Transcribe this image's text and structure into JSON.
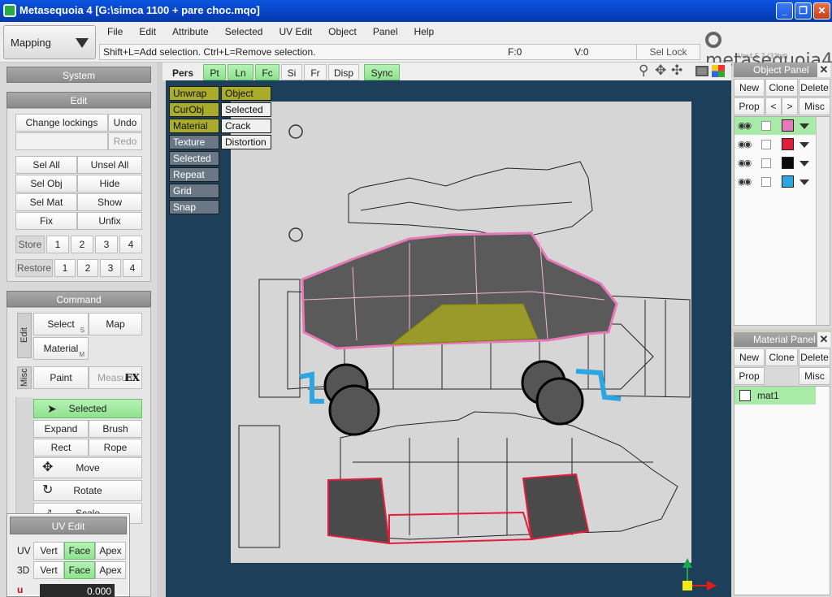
{
  "window": {
    "title": "Metasequoia 4 [G:\\simca 1100 + pare choc.mqo]"
  },
  "mode": {
    "label": "Mapping"
  },
  "menu": [
    "File",
    "Edit",
    "Attribute",
    "Selected",
    "UV Edit",
    "Object",
    "Panel",
    "Help"
  ],
  "status": {
    "hint": "Shift+L=Add selection.  Ctrl+L=Remove selection.",
    "faces": "F:0",
    "verts": "V:0",
    "sel_lock": "Sel Lock"
  },
  "logo": {
    "text": "metasequoia4",
    "version": "Ver4.5.7 (32bit)"
  },
  "system": {
    "title": "System"
  },
  "edit": {
    "title": "Edit",
    "change_lockings": "Change lockings",
    "undo": "Undo",
    "redo": "Redo",
    "sel_all": "Sel All",
    "unsel_all": "Unsel All",
    "sel_obj": "Sel Obj",
    "hide": "Hide",
    "sel_mat": "Sel Mat",
    "show": "Show",
    "fix": "Fix",
    "unfix": "Unfix",
    "store": "Store",
    "restore": "Restore",
    "slots": [
      "1",
      "2",
      "3",
      "4"
    ]
  },
  "command": {
    "title": "Command",
    "edit_tab": "Edit",
    "misc_tab": "Misc",
    "select": "Select",
    "select_sub": "S",
    "map": "Map",
    "material": "Material",
    "material_sub": "M",
    "paint": "Paint",
    "measure": "Measure",
    "measure_badge": "EX",
    "selected": "Selected",
    "expand": "Expand",
    "brush": "Brush",
    "rect": "Rect",
    "rope": "Rope",
    "move": "Move",
    "rotate": "Rotate",
    "scale": "Scale"
  },
  "uv_edit": {
    "title": "UV Edit",
    "uv_label": "UV",
    "d3_label": "3D",
    "vert": "Vert",
    "face": "Face",
    "apex": "Apex",
    "u_label": "u",
    "u_value": "0.000"
  },
  "viewport_toolbar": {
    "pers": "Pers",
    "pt": "Pt",
    "ln": "Ln",
    "fc": "Fc",
    "si": "Si",
    "fr": "Fr",
    "disp": "Disp",
    "sync": "Sync"
  },
  "viewport_overlay": {
    "left": [
      "Unwrap",
      "CurObj",
      "Material",
      "Texture",
      "Selected",
      "Repeat",
      "Grid",
      "Snap"
    ],
    "right": [
      "Object",
      "Selected",
      "Crack",
      "Distortion"
    ]
  },
  "object_panel": {
    "title": "Object Panel",
    "new": "New",
    "clone": "Clone",
    "delete": "Delete",
    "prop": "Prop",
    "prev": "<",
    "next": ">",
    "misc": "Misc",
    "rows": [
      {
        "color": "#e879b8",
        "selected": true
      },
      {
        "color": "#e01e3c",
        "selected": false
      },
      {
        "color": "#0a0a0a",
        "selected": false
      },
      {
        "color": "#2ba6e0",
        "selected": false
      }
    ]
  },
  "material_panel": {
    "title": "Material Panel",
    "new": "New",
    "clone": "Clone",
    "delete": "Delete",
    "prop": "Prop",
    "misc": "Misc",
    "items": [
      "mat1"
    ]
  },
  "colors": {
    "active_green": "#8ee28e",
    "viewport_bg": "#1e3f5a",
    "selection_pink": "#e879b8",
    "selected_face": "#9a9a2a"
  }
}
